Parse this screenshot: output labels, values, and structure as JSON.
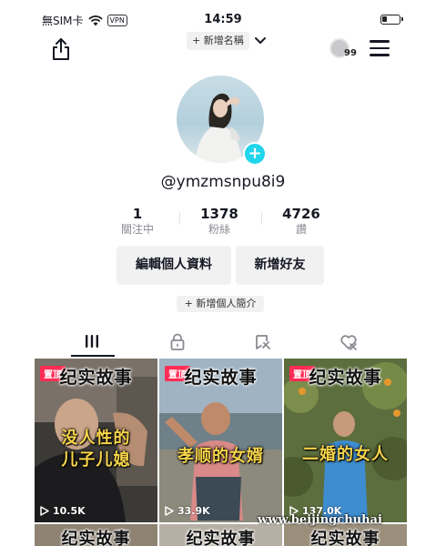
{
  "status_bar": {
    "carrier": "無SIM卡",
    "vpn": "VPN",
    "time": "14:59",
    "battery_level": 0.3
  },
  "header": {
    "add_name_label": "+ 新增名稱",
    "visitor_count": "99"
  },
  "profile": {
    "username": "@ymzmsnpu8i9",
    "add_avatar_symbol": "+",
    "stats": [
      {
        "value": "1",
        "label": "關注中"
      },
      {
        "value": "1378",
        "label": "粉絲"
      },
      {
        "value": "4726",
        "label": "讚"
      }
    ],
    "edit_profile_label": "編輯個人資料",
    "add_friend_label": "新增好友",
    "add_bio_label": "+ 新增個人簡介"
  },
  "tabs": [
    {
      "icon": "grid-icon",
      "active": true
    },
    {
      "icon": "lock-icon",
      "active": false
    },
    {
      "icon": "bookmark-icon",
      "active": false
    },
    {
      "icon": "heart-icon",
      "active": false
    }
  ],
  "videos": [
    {
      "pinned_label": "置頂",
      "title": "纪实故事",
      "caption": "没人性的\n儿子儿媳",
      "views": "10.5K"
    },
    {
      "pinned_label": "置頂",
      "title": "纪实故事",
      "caption": "孝顺的女婿",
      "views": "33.9K"
    },
    {
      "pinned_label": "置頂",
      "title": "纪实故事",
      "caption": "二婚的女人",
      "views": "137.0K"
    },
    {
      "title": "纪实故事"
    },
    {
      "title": "纪实故事"
    },
    {
      "title": "纪实故事"
    }
  ],
  "watermark": "www.beijingchuhai",
  "colors": {
    "accent": "#20d5ec",
    "pin": "#fe2c55",
    "caption_yellow": "#f6d44a"
  }
}
